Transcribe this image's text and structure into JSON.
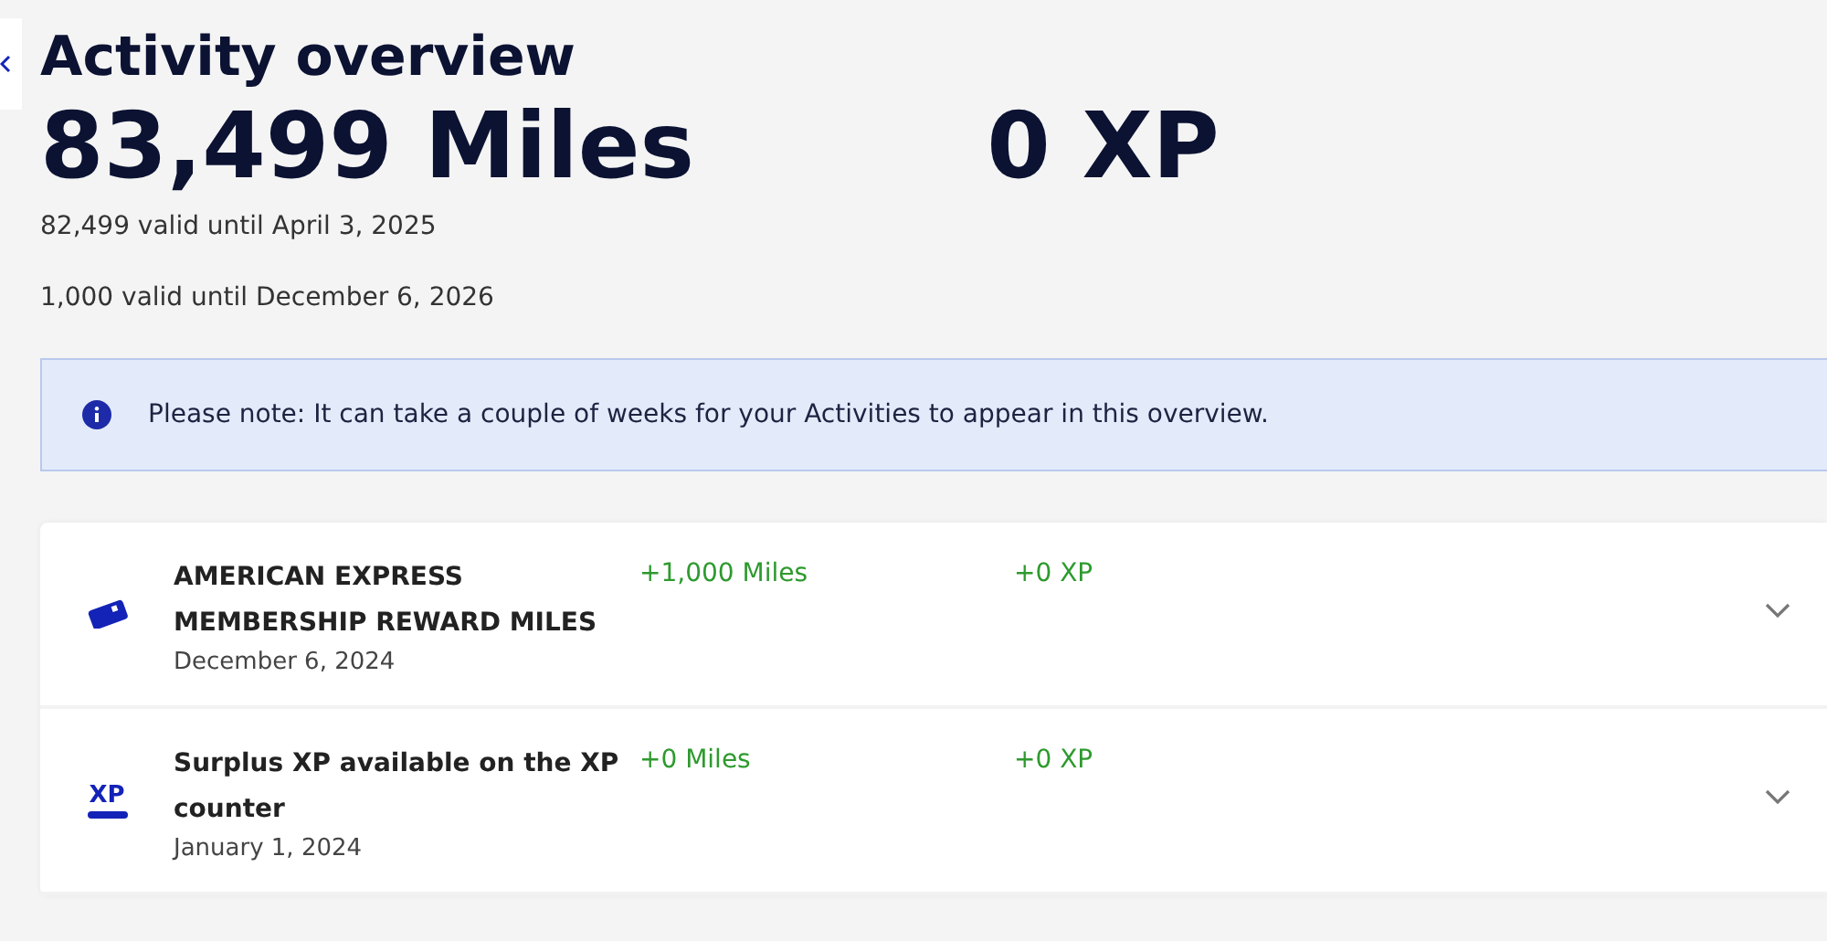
{
  "title": "Activity overview",
  "totals": {
    "miles": "83,499 Miles",
    "xp": "0 XP"
  },
  "validity": [
    "82,499 valid until April 3, 2025",
    "1,000 valid until December 6, 2026"
  ],
  "notice": {
    "text": "Please note: It can take a couple of weeks for your Activities to appear in this overview."
  },
  "activities": [
    {
      "kind": "card",
      "title": "AMERICAN EXPRESS MEMBERSHIP REWARD MILES",
      "date": "December 6, 2024",
      "miles": "+1,000 Miles",
      "xp": "+0 XP",
      "expanded": false
    },
    {
      "kind": "xp",
      "icon_text": "XP",
      "title": "Surplus XP available on the XP counter",
      "date": "January 1, 2024",
      "miles": "+0 Miles",
      "xp": "+0 XP",
      "expanded": false
    }
  ]
}
